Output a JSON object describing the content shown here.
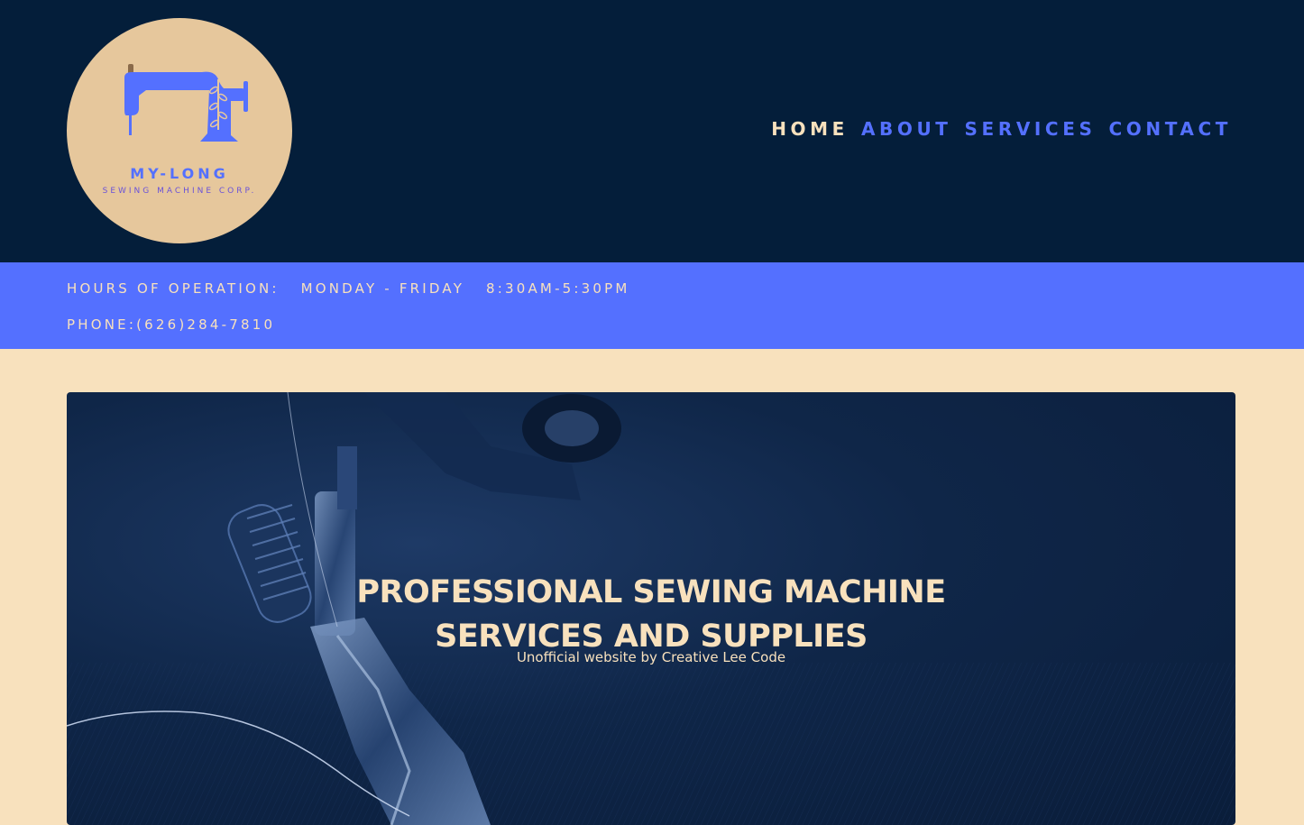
{
  "header": {
    "logo": {
      "icon": "sewing-machine-icon",
      "title": "MY-LONG",
      "subtitle": "SEWING MACHINE CORP."
    },
    "nav": {
      "items": [
        {
          "label": "HOME",
          "active": true
        },
        {
          "label": "ABOUT",
          "active": false
        },
        {
          "label": "SERVICES",
          "active": false
        },
        {
          "label": "CONTACT",
          "active": false
        }
      ]
    }
  },
  "infobar": {
    "hours": "HOURS OF OPERATION:   MONDAY - FRIDAY   8:30AM-5:30PM",
    "phone": "PHONE:(626)284-7810"
  },
  "hero": {
    "background_image": "sewing-machine-presser-foot-photo",
    "title_line1": "PROFESSIONAL SEWING MACHINE",
    "title_line2": "SERVICES AND SUPPLIES",
    "subtitle": "Unofficial website by Creative Lee Code"
  },
  "colors": {
    "header_bg": "#041e3a",
    "accent": "#5470ff",
    "cream": "#f8e1bd",
    "logo_bg": "#e6c79c"
  }
}
